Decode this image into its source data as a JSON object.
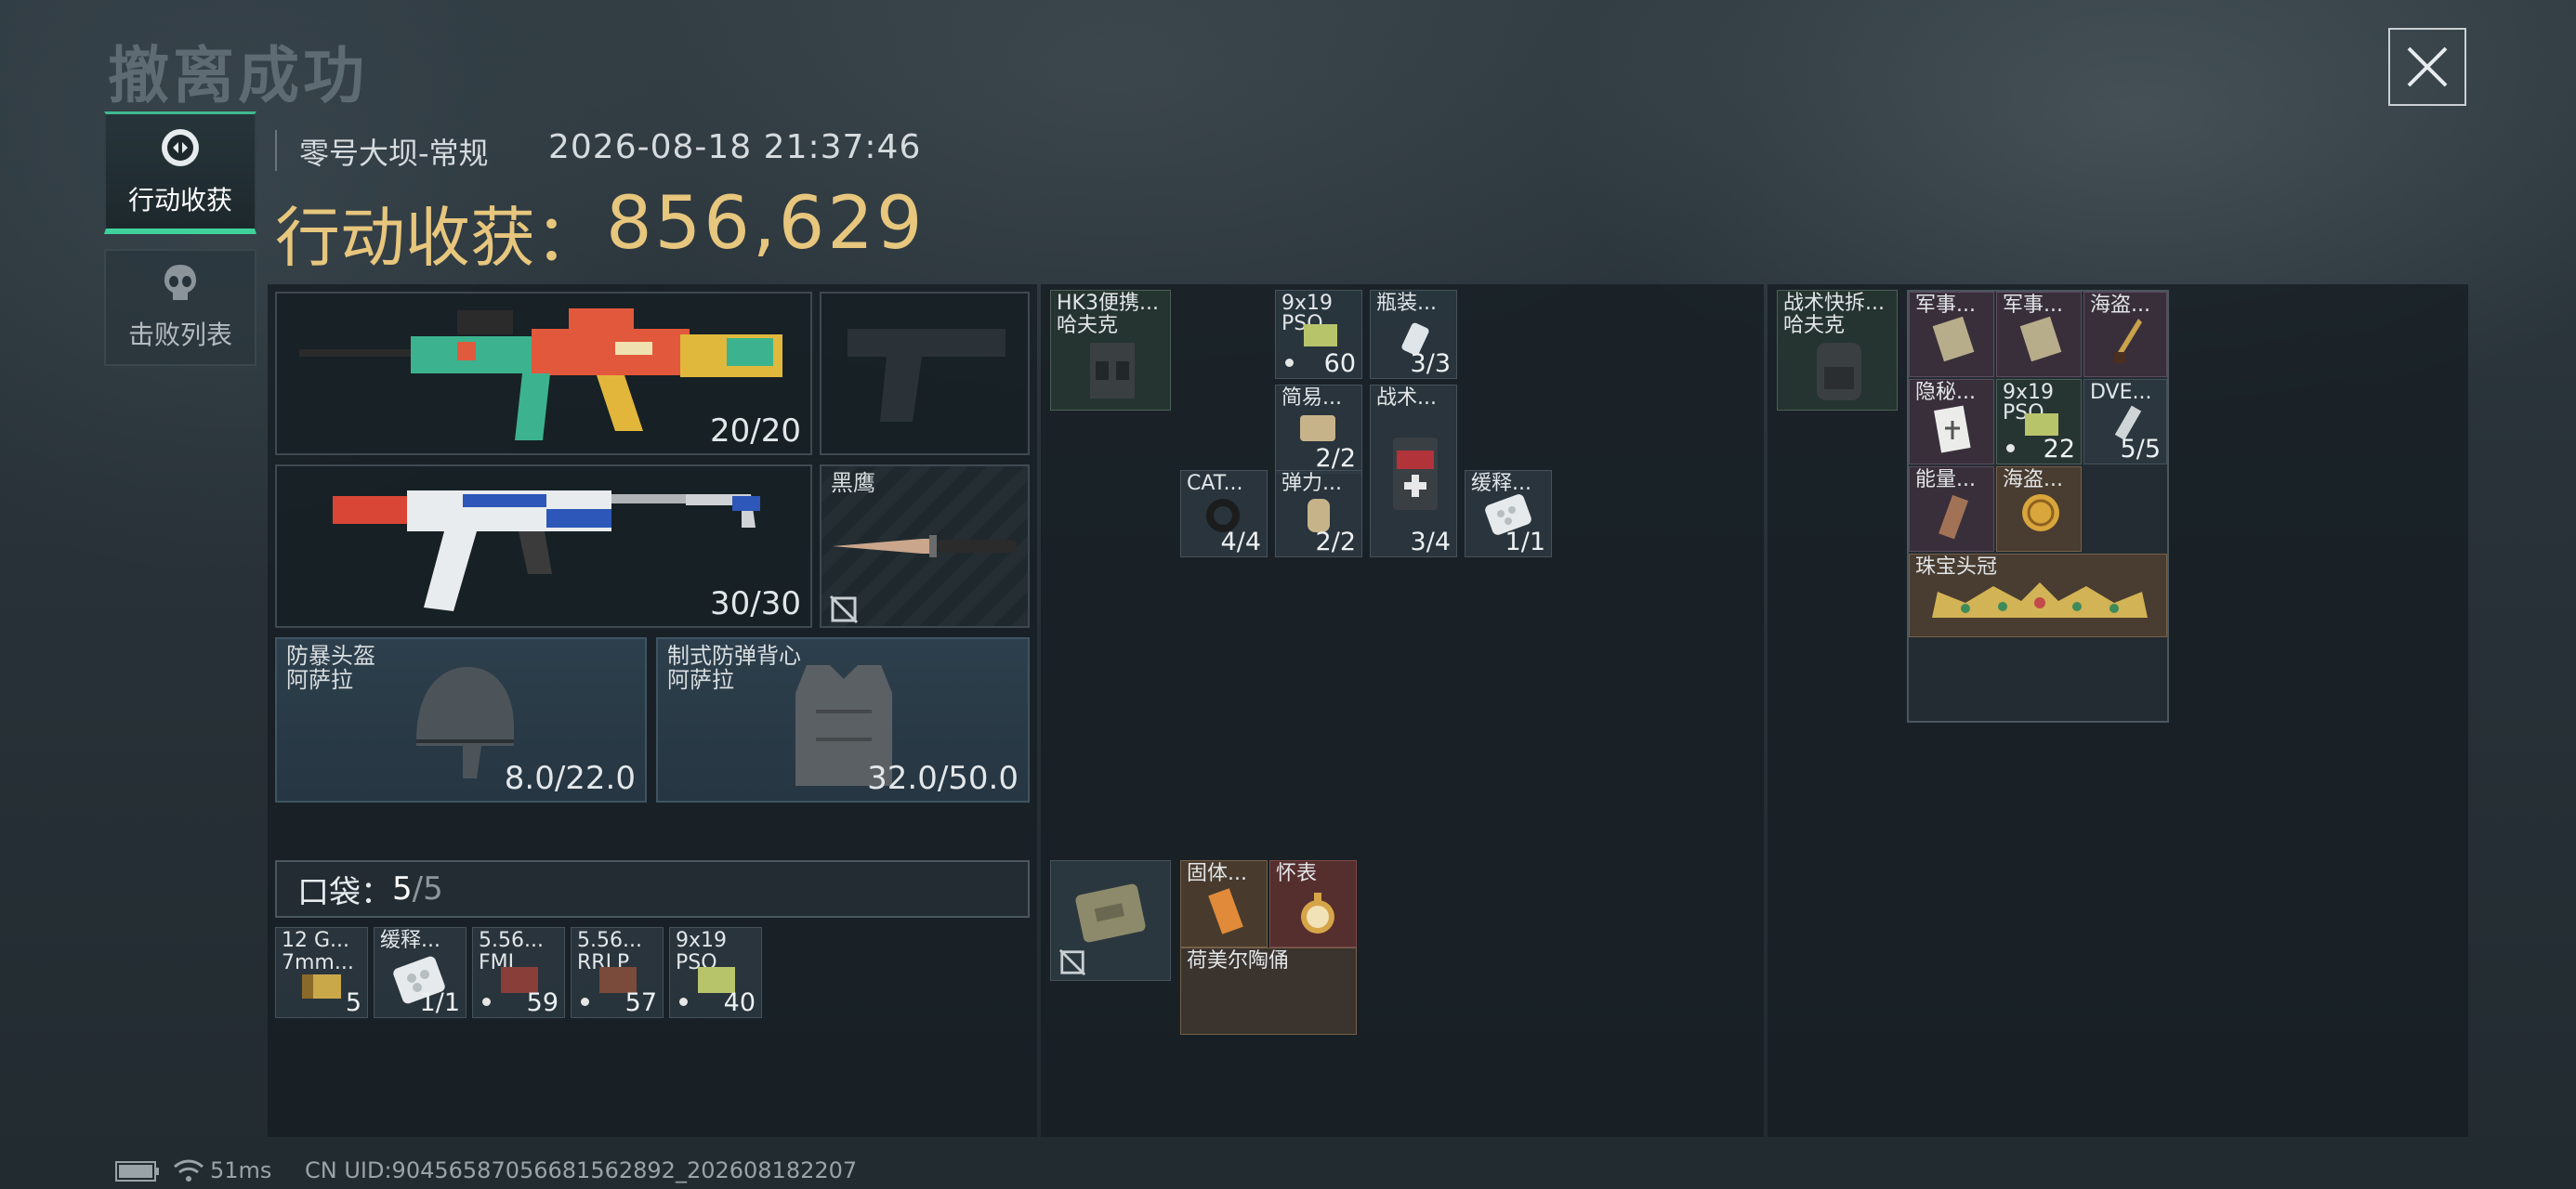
{
  "header": {
    "title": "撤离成功",
    "map": "零号大坝-常规",
    "time": "2026-08-18 21:37:46"
  },
  "tabs": [
    {
      "label": "行动收获",
      "active": true
    },
    {
      "label": "击败列表",
      "active": false
    }
  ],
  "profit": {
    "label": "行动收获：",
    "value": "856,629"
  },
  "gear": {
    "primary": {
      "ammo": "20/20"
    },
    "secondary": {
      "ammo": "30/30"
    },
    "melee": {
      "name": "黑鹰"
    },
    "helmet": {
      "type": "防暴头盔",
      "name": "阿萨拉",
      "durability": "8.0/22.0"
    },
    "armor": {
      "type": "制式防弹背心",
      "name": "阿萨拉",
      "durability": "32.0/50.0"
    }
  },
  "pocket": {
    "label": "口袋：",
    "count": "5",
    "sep": "/",
    "max": "5",
    "items": [
      {
        "l1": "12 G...",
        "l2": "7mm...",
        "count": "5"
      },
      {
        "l1": "缓释...",
        "l2": "",
        "count": "1/1"
      },
      {
        "l1": "5.56...",
        "l2": "FMJ",
        "count": "59"
      },
      {
        "l1": "5.56...",
        "l2": "RRLP",
        "count": "57"
      },
      {
        "l1": "9x19",
        "l2": "PSO",
        "count": "40"
      }
    ]
  },
  "rig": {
    "name1": "HK3便携...",
    "name2": "哈夫克"
  },
  "rig_items": [
    {
      "l1": "9x19",
      "l2": "PSO",
      "count": "60"
    },
    {
      "l1": "瓶装...",
      "count": "3/3"
    },
    {
      "l1": "简易...",
      "count": "2/2"
    },
    {
      "l1": "战术...",
      "count": "3/4"
    },
    {
      "l1": "CAT...",
      "count": "4/4"
    },
    {
      "l1": "弹力...",
      "count": "2/2"
    },
    {
      "l1": "缓释...",
      "count": "1/1"
    }
  ],
  "case_items": [
    {
      "l1": "固体..."
    },
    {
      "l1": "怀表"
    },
    {
      "l1": "荷美尔陶俑"
    }
  ],
  "backpack": {
    "name1": "战术快拆...",
    "name2": "哈夫克"
  },
  "backpack_items": [
    {
      "l1": "军事..."
    },
    {
      "l1": "军事..."
    },
    {
      "l1": "海盗..."
    },
    {
      "l1": "隐秘..."
    },
    {
      "l1": "9x19",
      "l2": "PSO",
      "count": "22"
    },
    {
      "l1": "DVE...",
      "count": "5/5"
    },
    {
      "l1": "能量..."
    },
    {
      "l1": "海盗..."
    },
    {
      "l1": "珠宝头冠"
    }
  ],
  "footer": {
    "ping": "51ms",
    "uid": "CN UID:9045658705668156289​2_202608182207"
  }
}
